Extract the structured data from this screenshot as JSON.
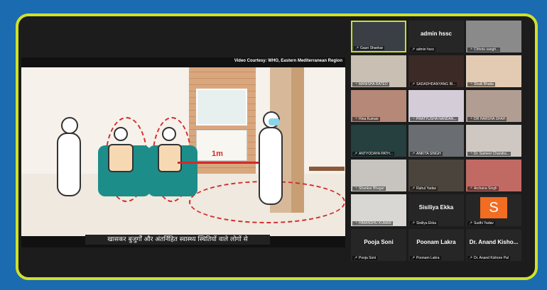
{
  "shared_screen": {
    "courtesy": "Video Courtesy: WHO, Eastern Mediterranean Region",
    "distance_label": "1m",
    "caption": "खासकर बुजुर्गों और अंतर्निहित स्वास्थ्य स्थितियों वाले लोगों से"
  },
  "gallery": {
    "tiles": [
      {
        "label": "Gauri Shankar",
        "type": "video",
        "bg": "#3a3f46",
        "active": true
      },
      {
        "label": "admin hssc",
        "sub": "admin hssc",
        "type": "name"
      },
      {
        "label": "Chhotu sangh...",
        "type": "video",
        "bg": "#8a8a8a"
      },
      {
        "label": "MANISHA RATEO",
        "type": "video",
        "bg": "#c9bfb3"
      },
      {
        "label": "SADADHDANYANG BI...",
        "type": "video",
        "bg": "#3b2a26"
      },
      {
        "label": "Shaili Bhatia",
        "type": "video",
        "bg": "#e3cbb3"
      },
      {
        "label": "Hina Kumari",
        "type": "video",
        "bg": "#b58878"
      },
      {
        "label": "PRATYUSHA NANDAN...",
        "type": "video",
        "bg": "#d4ccd7"
      },
      {
        "label": "DR HARSHA SHAH",
        "type": "video",
        "bg": "#b19d92"
      },
      {
        "label": "ANTYODAYA PATH...",
        "type": "video",
        "bg": "#263f3f"
      },
      {
        "label": "ANKITA SINGH",
        "type": "video",
        "bg": "#6a6e72"
      },
      {
        "label": "Dr. Sameer Chandra...",
        "type": "video",
        "bg": "#cfc8c2"
      },
      {
        "label": "Shankar Bhagat",
        "type": "video",
        "bg": "#c7c4bf"
      },
      {
        "label": "Rahul Yadav",
        "type": "video",
        "bg": "#4a443c"
      },
      {
        "label": "Archana Singh",
        "type": "video",
        "bg": "#c16a63"
      },
      {
        "label": "HIMANSHU KUMAR",
        "type": "video",
        "bg": "#d9d7d3"
      },
      {
        "label": "Sisiliya Ekka",
        "sub": "Sisiliya Ekka",
        "type": "name"
      },
      {
        "label": "Sudhi Yadav",
        "type": "avatar",
        "letter": "S"
      },
      {
        "label": "Pooja Soni",
        "sub": "Pooja Soni",
        "type": "name"
      },
      {
        "label": "Poonam Lakra",
        "sub": "Poonam Lakra",
        "type": "name"
      },
      {
        "label": "Dr. Anand Kisho...",
        "sub": "Dr. Anand Kishore Pal",
        "type": "name"
      }
    ]
  }
}
